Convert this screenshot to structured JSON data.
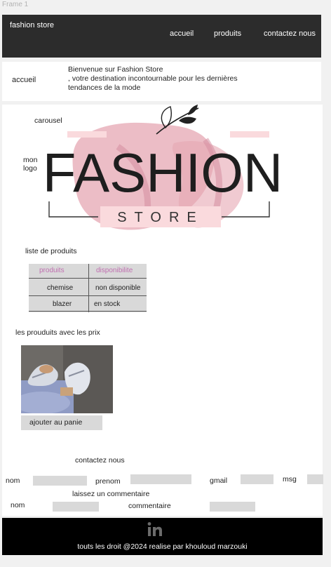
{
  "frame": {
    "label": "Frame 1"
  },
  "header": {
    "brand": "fashion store",
    "nav": [
      "accueil",
      "produits",
      "contactez nous"
    ]
  },
  "intro": {
    "breadcrumb": "accueil",
    "welcome": "Bienvenue sur Fashion Store\n, votre destination incontournable pour les dernières tendances de la mode"
  },
  "main": {
    "carousel_label": "carousel",
    "logo_label": "mon\nlogo",
    "logo": {
      "title": "FASHION",
      "subtitle": "STORE"
    },
    "products_title": "liste de produits",
    "product_table": {
      "headers": [
        "produits",
        "disponibilite"
      ],
      "rows": [
        [
          "chemise",
          "non disponible"
        ],
        [
          "blazer",
          "en stock"
        ]
      ]
    },
    "prices_title": "les prouduits  avec les prix",
    "add_to_cart": "ajouter au panie"
  },
  "contact": {
    "title": "contactez nous",
    "labels": {
      "nom": "nom",
      "prenom": "prenom",
      "gmail": "gmail",
      "msg": "msg"
    },
    "comment_title": "laissez un commentaire",
    "comment_labels": {
      "nom": "nom",
      "commentaire": "commentaire"
    }
  },
  "footer": {
    "social_icon": "linkedin-icon",
    "text": "touts les droit @2024 realise par khouloud marzouki"
  },
  "colors": {
    "header_bg": "#2c2c2c",
    "footer_bg": "#000000",
    "field_bg": "#d9d9d9",
    "logo_pink": "#e6a7b3",
    "table_header_text": "#c06fb0"
  }
}
